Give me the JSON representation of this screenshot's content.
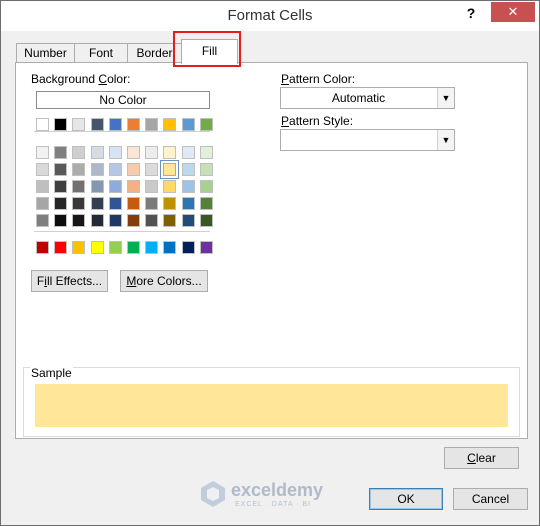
{
  "window": {
    "title": "Format Cells",
    "help_label": "?",
    "close_label": "✕"
  },
  "tabs": [
    {
      "label": "Number"
    },
    {
      "label": "Font"
    },
    {
      "label": "Border"
    },
    {
      "label": "Fill"
    }
  ],
  "active_tab": "Fill",
  "fill": {
    "background_color_label": "Background Color:",
    "no_color_label": "No Color",
    "fill_effects_label": "Fill Effects...",
    "more_colors_label": "More Colors...",
    "pattern_color_label": "Pattern Color:",
    "pattern_color_value": "Automatic",
    "pattern_style_label": "Pattern Style:",
    "pattern_style_value": "",
    "sample_label": "Sample",
    "sample_color": "#ffe699",
    "clear_label": "Clear"
  },
  "palette": {
    "theme_top": [
      "#ffffff",
      "#000000",
      "#e7e6e6",
      "#44546a",
      "#4472c4",
      "#ed7d31",
      "#a5a5a5",
      "#ffc000",
      "#5b9bd5",
      "#70ad47"
    ],
    "theme_shades": [
      [
        "#f2f2f2",
        "#808080",
        "#d0cece",
        "#d6dce4",
        "#dae3f3",
        "#fbe5d6",
        "#ededed",
        "#fff2cc",
        "#deebf7",
        "#e2f0d9"
      ],
      [
        "#d9d9d9",
        "#595959",
        "#aeabab",
        "#adb9ca",
        "#b4c7e7",
        "#f8cbad",
        "#dbdbdb",
        "#ffe699",
        "#bdd7ee",
        "#c5e0b4"
      ],
      [
        "#bfbfbf",
        "#404040",
        "#767171",
        "#8497b0",
        "#8faadc",
        "#f4b183",
        "#c9c9c9",
        "#ffd966",
        "#9dc3e6",
        "#a9d18e"
      ],
      [
        "#a6a6a6",
        "#262626",
        "#3b3838",
        "#333f50",
        "#2f5597",
        "#c55a11",
        "#7b7b7b",
        "#bf9000",
        "#2e75b6",
        "#548235"
      ],
      [
        "#7f7f7f",
        "#0d0d0d",
        "#171515",
        "#222a35",
        "#203864",
        "#843c0c",
        "#525252",
        "#7f6000",
        "#1f4e79",
        "#385723"
      ]
    ],
    "standard": [
      "#c00000",
      "#ff0000",
      "#ffc000",
      "#ffff00",
      "#92d050",
      "#00b050",
      "#00b0f0",
      "#0070c0",
      "#002060",
      "#7030a0"
    ],
    "selected": "#ffe699"
  },
  "buttons": {
    "ok_label": "OK",
    "cancel_label": "Cancel"
  },
  "watermark": {
    "name": "exceldemy",
    "tagline": "EXCEL · DATA · BI"
  }
}
